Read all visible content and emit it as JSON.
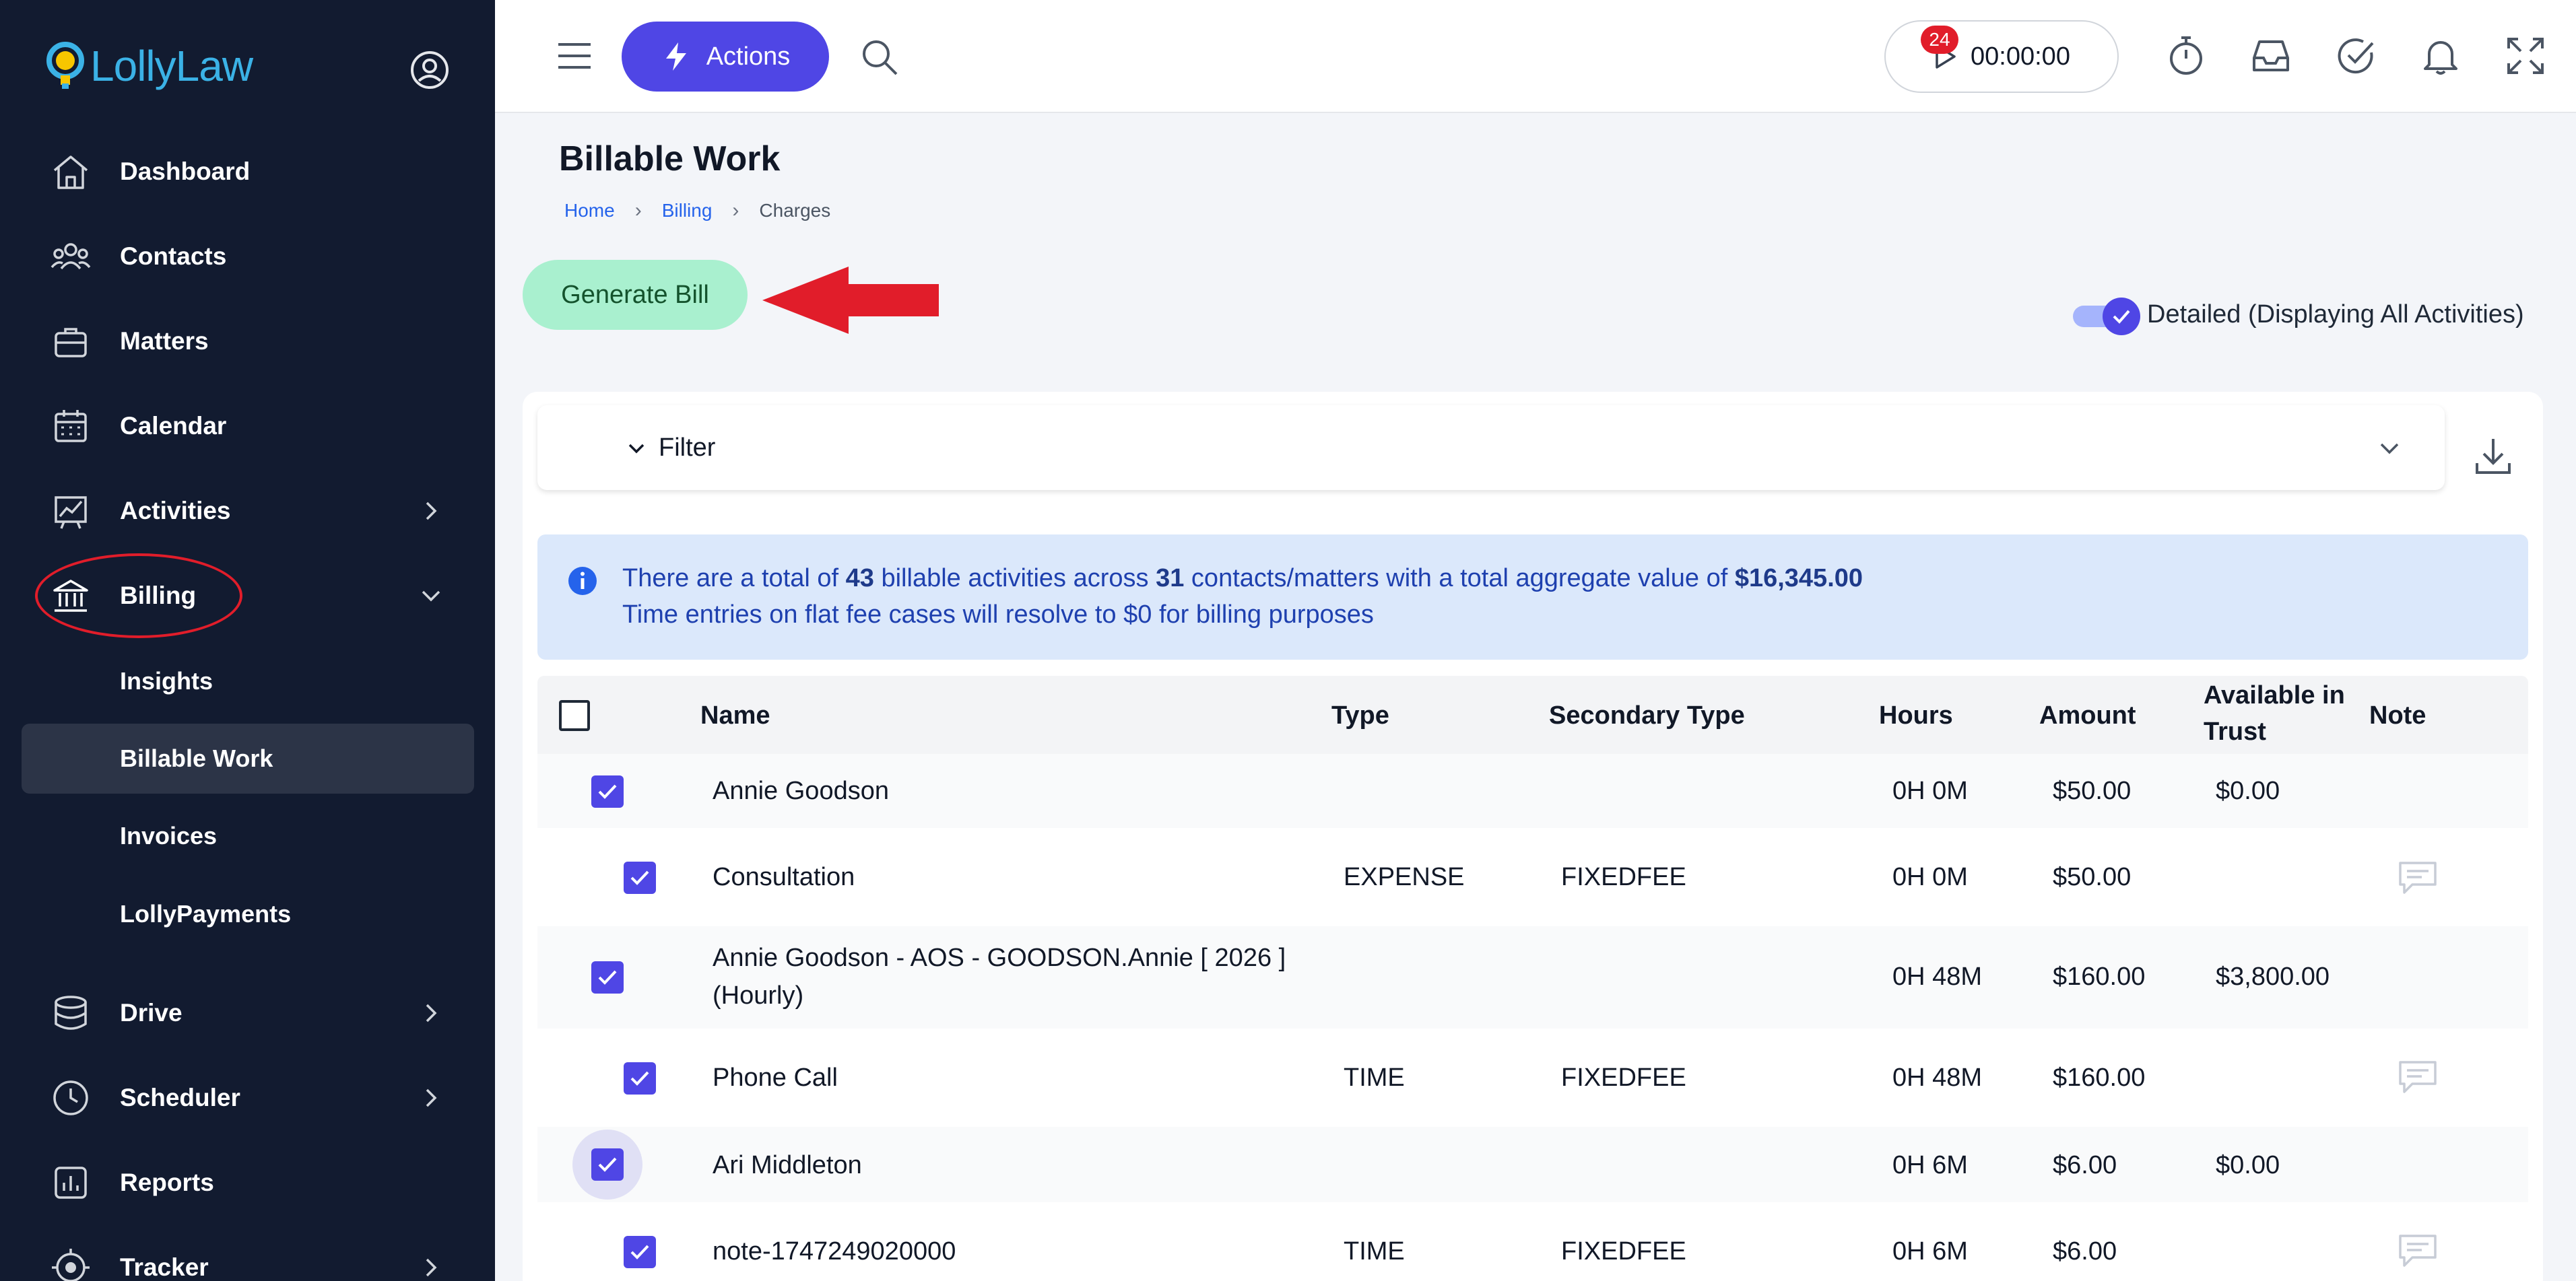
{
  "app": {
    "logo_text": "LollyLaw"
  },
  "sidebar": {
    "items": [
      {
        "label": "Dashboard",
        "icon": "home-icon"
      },
      {
        "label": "Contacts",
        "icon": "people-icon"
      },
      {
        "label": "Matters",
        "icon": "briefcase-icon"
      },
      {
        "label": "Calendar",
        "icon": "calendar-icon"
      },
      {
        "label": "Activities",
        "icon": "chart-icon"
      },
      {
        "label": "Billing",
        "icon": "bank-icon"
      },
      {
        "label": "Drive",
        "icon": "database-icon"
      },
      {
        "label": "Scheduler",
        "icon": "clock-icon"
      },
      {
        "label": "Reports",
        "icon": "bar-chart-icon"
      },
      {
        "label": "Tracker",
        "icon": "target-icon"
      }
    ],
    "billing_sub": [
      {
        "label": "Insights"
      },
      {
        "label": "Billable Work",
        "active": true
      },
      {
        "label": "Invoices"
      },
      {
        "label": "LollyPayments"
      }
    ]
  },
  "topbar": {
    "actions_label": "Actions",
    "timer": "00:00:00",
    "notification_count": "24"
  },
  "page": {
    "title": "Billable Work",
    "breadcrumb": [
      "Home",
      "Billing",
      "Charges"
    ],
    "generate_label": "Generate Bill",
    "toggle_label": "Detailed (Displaying All Activities)",
    "toggle_on": true
  },
  "filter": {
    "label": "Filter"
  },
  "info": {
    "p1": "There are a total of ",
    "count": "43",
    "p2": " billable activities across ",
    "contacts": "31",
    "p3": " contacts/matters with a total aggregate value of ",
    "total": "$16,345.00",
    "line2": "Time entries on flat fee cases will resolve to $0 for billing purposes"
  },
  "table": {
    "headers": {
      "name": "Name",
      "type": "Type",
      "secondary": "Secondary Type",
      "hours": "Hours",
      "amount": "Amount",
      "trust_1": "Available in",
      "trust_2": "Trust",
      "note": "Note"
    },
    "rows": [
      {
        "name": "Annie Goodson",
        "type": "",
        "secondary": "",
        "hours": "0H 0M",
        "amount": "$50.00",
        "trust": "$0.00"
      },
      {
        "name": "Consultation",
        "type": "EXPENSE",
        "secondary": "FIXEDFEE",
        "hours": "0H 0M",
        "amount": "$50.00",
        "trust": ""
      },
      {
        "name_1": "Annie Goodson - AOS - GOODSON.Annie [ 2026 ]",
        "name_2": "(Hourly)",
        "type": "",
        "secondary": "",
        "hours": "0H 48M",
        "amount": "$160.00",
        "trust": "$3,800.00"
      },
      {
        "name": "Phone Call",
        "type": "TIME",
        "secondary": "FIXEDFEE",
        "hours": "0H 48M",
        "amount": "$160.00",
        "trust": ""
      },
      {
        "name": "Ari Middleton",
        "type": "",
        "secondary": "",
        "hours": "0H 6M",
        "amount": "$6.00",
        "trust": "$0.00"
      },
      {
        "name": "note-1747249020000",
        "type": "TIME",
        "secondary": "FIXEDFEE",
        "hours": "0H 6M",
        "amount": "$6.00",
        "trust": ""
      }
    ]
  },
  "colors": {
    "accent": "#4f46e5",
    "sidebar_bg": "#121b30",
    "generate_bg": "#a9f0cf",
    "info_bg": "#dbe8fb",
    "annotation_red": "#e11d2a"
  }
}
